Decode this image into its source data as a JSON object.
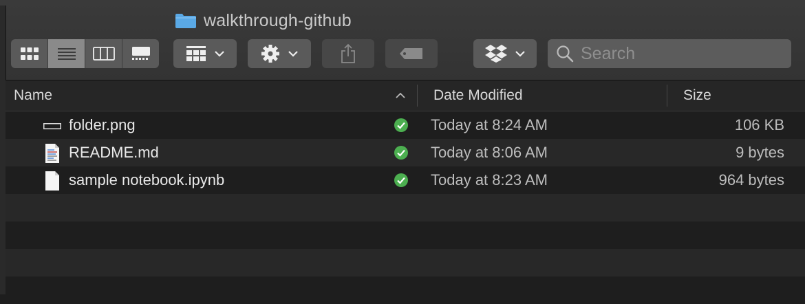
{
  "window": {
    "title": "walkthrough-github"
  },
  "toolbar": {
    "view_modes": [
      {
        "icon": "icon-view-icon",
        "active": false
      },
      {
        "icon": "list-view-icon",
        "active": true
      },
      {
        "icon": "column-view-icon",
        "active": false
      },
      {
        "icon": "gallery-view-icon",
        "active": false
      }
    ],
    "group_icon": "group-by-icon",
    "action_icon": "gear-icon",
    "share_icon": "share-icon",
    "tags_icon": "tag-icon",
    "dropbox_icon": "dropbox-icon"
  },
  "search": {
    "placeholder": "Search",
    "value": ""
  },
  "columns": {
    "name": "Name",
    "date_modified": "Date Modified",
    "size": "Size"
  },
  "files": [
    {
      "name": "folder.png",
      "date": "Today at 8:24 AM",
      "size": "106 KB",
      "icon": "image-file-icon",
      "sync": "synced-check-icon"
    },
    {
      "name": "README.md",
      "date": "Today at 8:06 AM",
      "size": "9 bytes",
      "icon": "text-document-icon",
      "sync": "synced-check-icon"
    },
    {
      "name": "sample notebook.ipynb",
      "date": "Today at 8:23 AM",
      "size": "964 bytes",
      "icon": "blank-document-icon",
      "sync": "synced-check-icon"
    }
  ],
  "colors": {
    "sync_green": "#4caf50",
    "folder_blue": "#5aa9e6"
  }
}
